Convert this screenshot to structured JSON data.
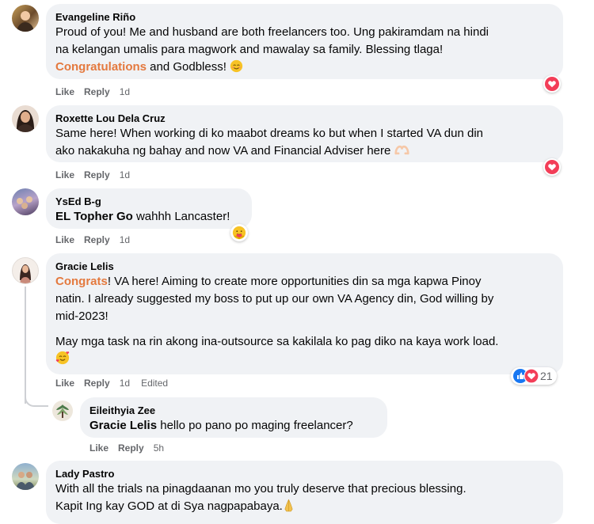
{
  "comments": [
    {
      "author": "Evangeline Riño",
      "lines": [
        "Proud of you! Me and husband are both freelancers too. Ung pakiramdam na hindi",
        "na kelangan umalis para magwork and mawalay sa family. Blessing tlaga!"
      ],
      "highlight": "Congratulations",
      "tail": " and Godbless!",
      "tail_emoji": "smiling-face-emoji",
      "like": "Like",
      "reply": "Reply",
      "time": "1d",
      "reaction": "love-reaction-icon"
    },
    {
      "author": "Roxette Lou Dela Cruz",
      "lines": [
        "Same here! When working di ko maabot dreams ko but when I started VA dun din",
        "ako nakakuha ng bahay and now VA and Financial Adviser here"
      ],
      "tail_emoji": "heart-hands-emoji",
      "like": "Like",
      "reply": "Reply",
      "time": "1d",
      "reaction": "love-reaction-icon"
    },
    {
      "author": "YsEd B-g",
      "mention": "EL Topher Go",
      "text": " wahhh Lancaster!",
      "like": "Like",
      "reply": "Reply",
      "time": "1d",
      "reaction": "care-reaction-icon"
    },
    {
      "author": "Gracie Lelis",
      "highlight": "Congrats",
      "line1_rest": "! VA here! Aiming to create more opportunities din sa mga kapwa Pinoy",
      "lines": [
        "natin. I already suggested my boss to put up our own VA Agency din, God willing by",
        "mid-2023!"
      ],
      "para2": "May mga task na rin akong ina-outsource sa kakilala ko pag diko na kaya work load.",
      "para2_emoji": "smiling-face-with-hearts-emoji",
      "like": "Like",
      "reply": "Reply",
      "time": "1d",
      "edited": "Edited",
      "reaction_count": "21"
    },
    {
      "author": "Eileithyia Zee",
      "mention": "Gracie Lelis",
      "text": " hello po pano po maging freelancer?",
      "like": "Like",
      "reply": "Reply",
      "time": "5h"
    },
    {
      "author": "Lady Pastro",
      "lines": [
        "With all the trials na pinagdaanan mo you truly deserve that precious blessing.",
        "Kapit Ing kay GOD at di Sya nagpapabaya."
      ],
      "tail_emoji": "folded-hands-emoji"
    }
  ],
  "colors": {
    "bubble": "#f0f2f5",
    "highlight": "#e4793e",
    "meta": "#65676b",
    "love": "#f33e58",
    "like_blue": "#1877f2"
  }
}
